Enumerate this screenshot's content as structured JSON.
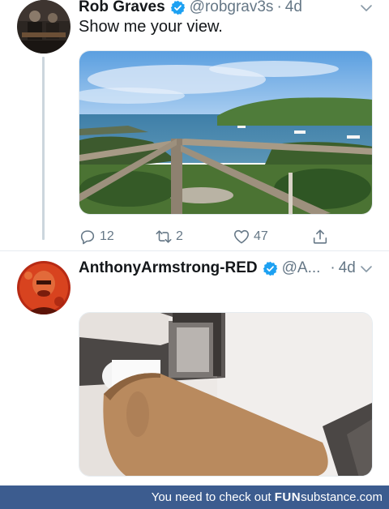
{
  "tweets": [
    {
      "name": "Rob Graves",
      "handle": "@robgrav3s",
      "separator": "·",
      "time": "4d",
      "text": "Show me your view.",
      "replies": "12",
      "retweets": "2",
      "likes": "47"
    },
    {
      "name": "AnthonyArmstrong-RED",
      "handle": "@A...",
      "separator": "·",
      "time": "4d"
    }
  ],
  "icons": {
    "verified": "verified-badge-icon",
    "chevron": "chevron-down-icon",
    "reply": "reply-icon",
    "retweet": "retweet-icon",
    "like": "heart-icon",
    "share": "share-icon"
  },
  "colors": {
    "verified": "#1da1f2",
    "muted": "#657786",
    "footer": "#3c5c8f"
  },
  "footer": {
    "prefix": "You need to check out ",
    "brand_fun": "FUN",
    "brand_substance": "substance",
    "suffix": ".com"
  }
}
